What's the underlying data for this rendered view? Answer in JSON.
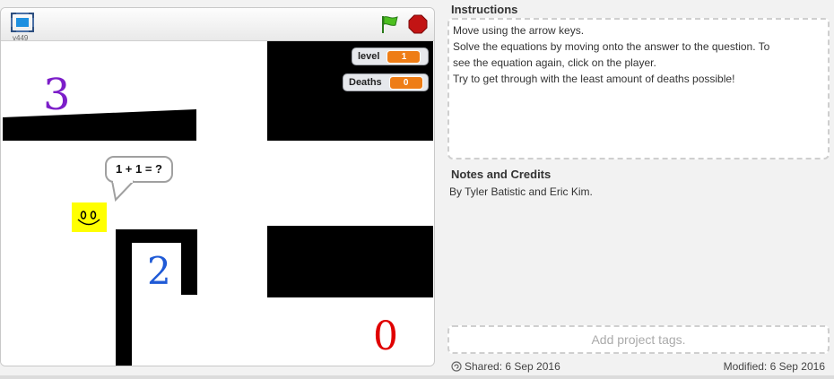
{
  "player": {
    "version": "v449",
    "icons": {
      "fullscreen": "fullscreen-icon",
      "green_flag": "green-flag-icon",
      "stop": "stop-icon"
    },
    "monitors": [
      {
        "label": "level",
        "value": "1"
      },
      {
        "label": "Deaths",
        "value": "0"
      }
    ],
    "speech": "1 + 1 = ?",
    "answers": [
      {
        "text": "3",
        "color": "#7c1ec9"
      },
      {
        "text": "2",
        "color": "#1f5ad6"
      },
      {
        "text": "0",
        "color": "#e00000"
      }
    ],
    "colors": {
      "player": "#ffff00",
      "walls": "#000000",
      "monitor_value": "#ee7d16"
    }
  },
  "instructions": {
    "title": "Instructions",
    "lines": [
      "Move using the arrow keys.",
      "Solve the equations by moving onto the answer to the question.  To",
      "see the equation again, click on the player.",
      "Try to get through with the least amount of deaths possible!"
    ]
  },
  "notes": {
    "title": "Notes and Credits",
    "text": "By Tyler Batistic and Eric Kim."
  },
  "tags": {
    "placeholder": "Add project tags."
  },
  "footer": {
    "shared": "Shared: 6 Sep 2016",
    "modified": "Modified: 6 Sep 2016"
  }
}
